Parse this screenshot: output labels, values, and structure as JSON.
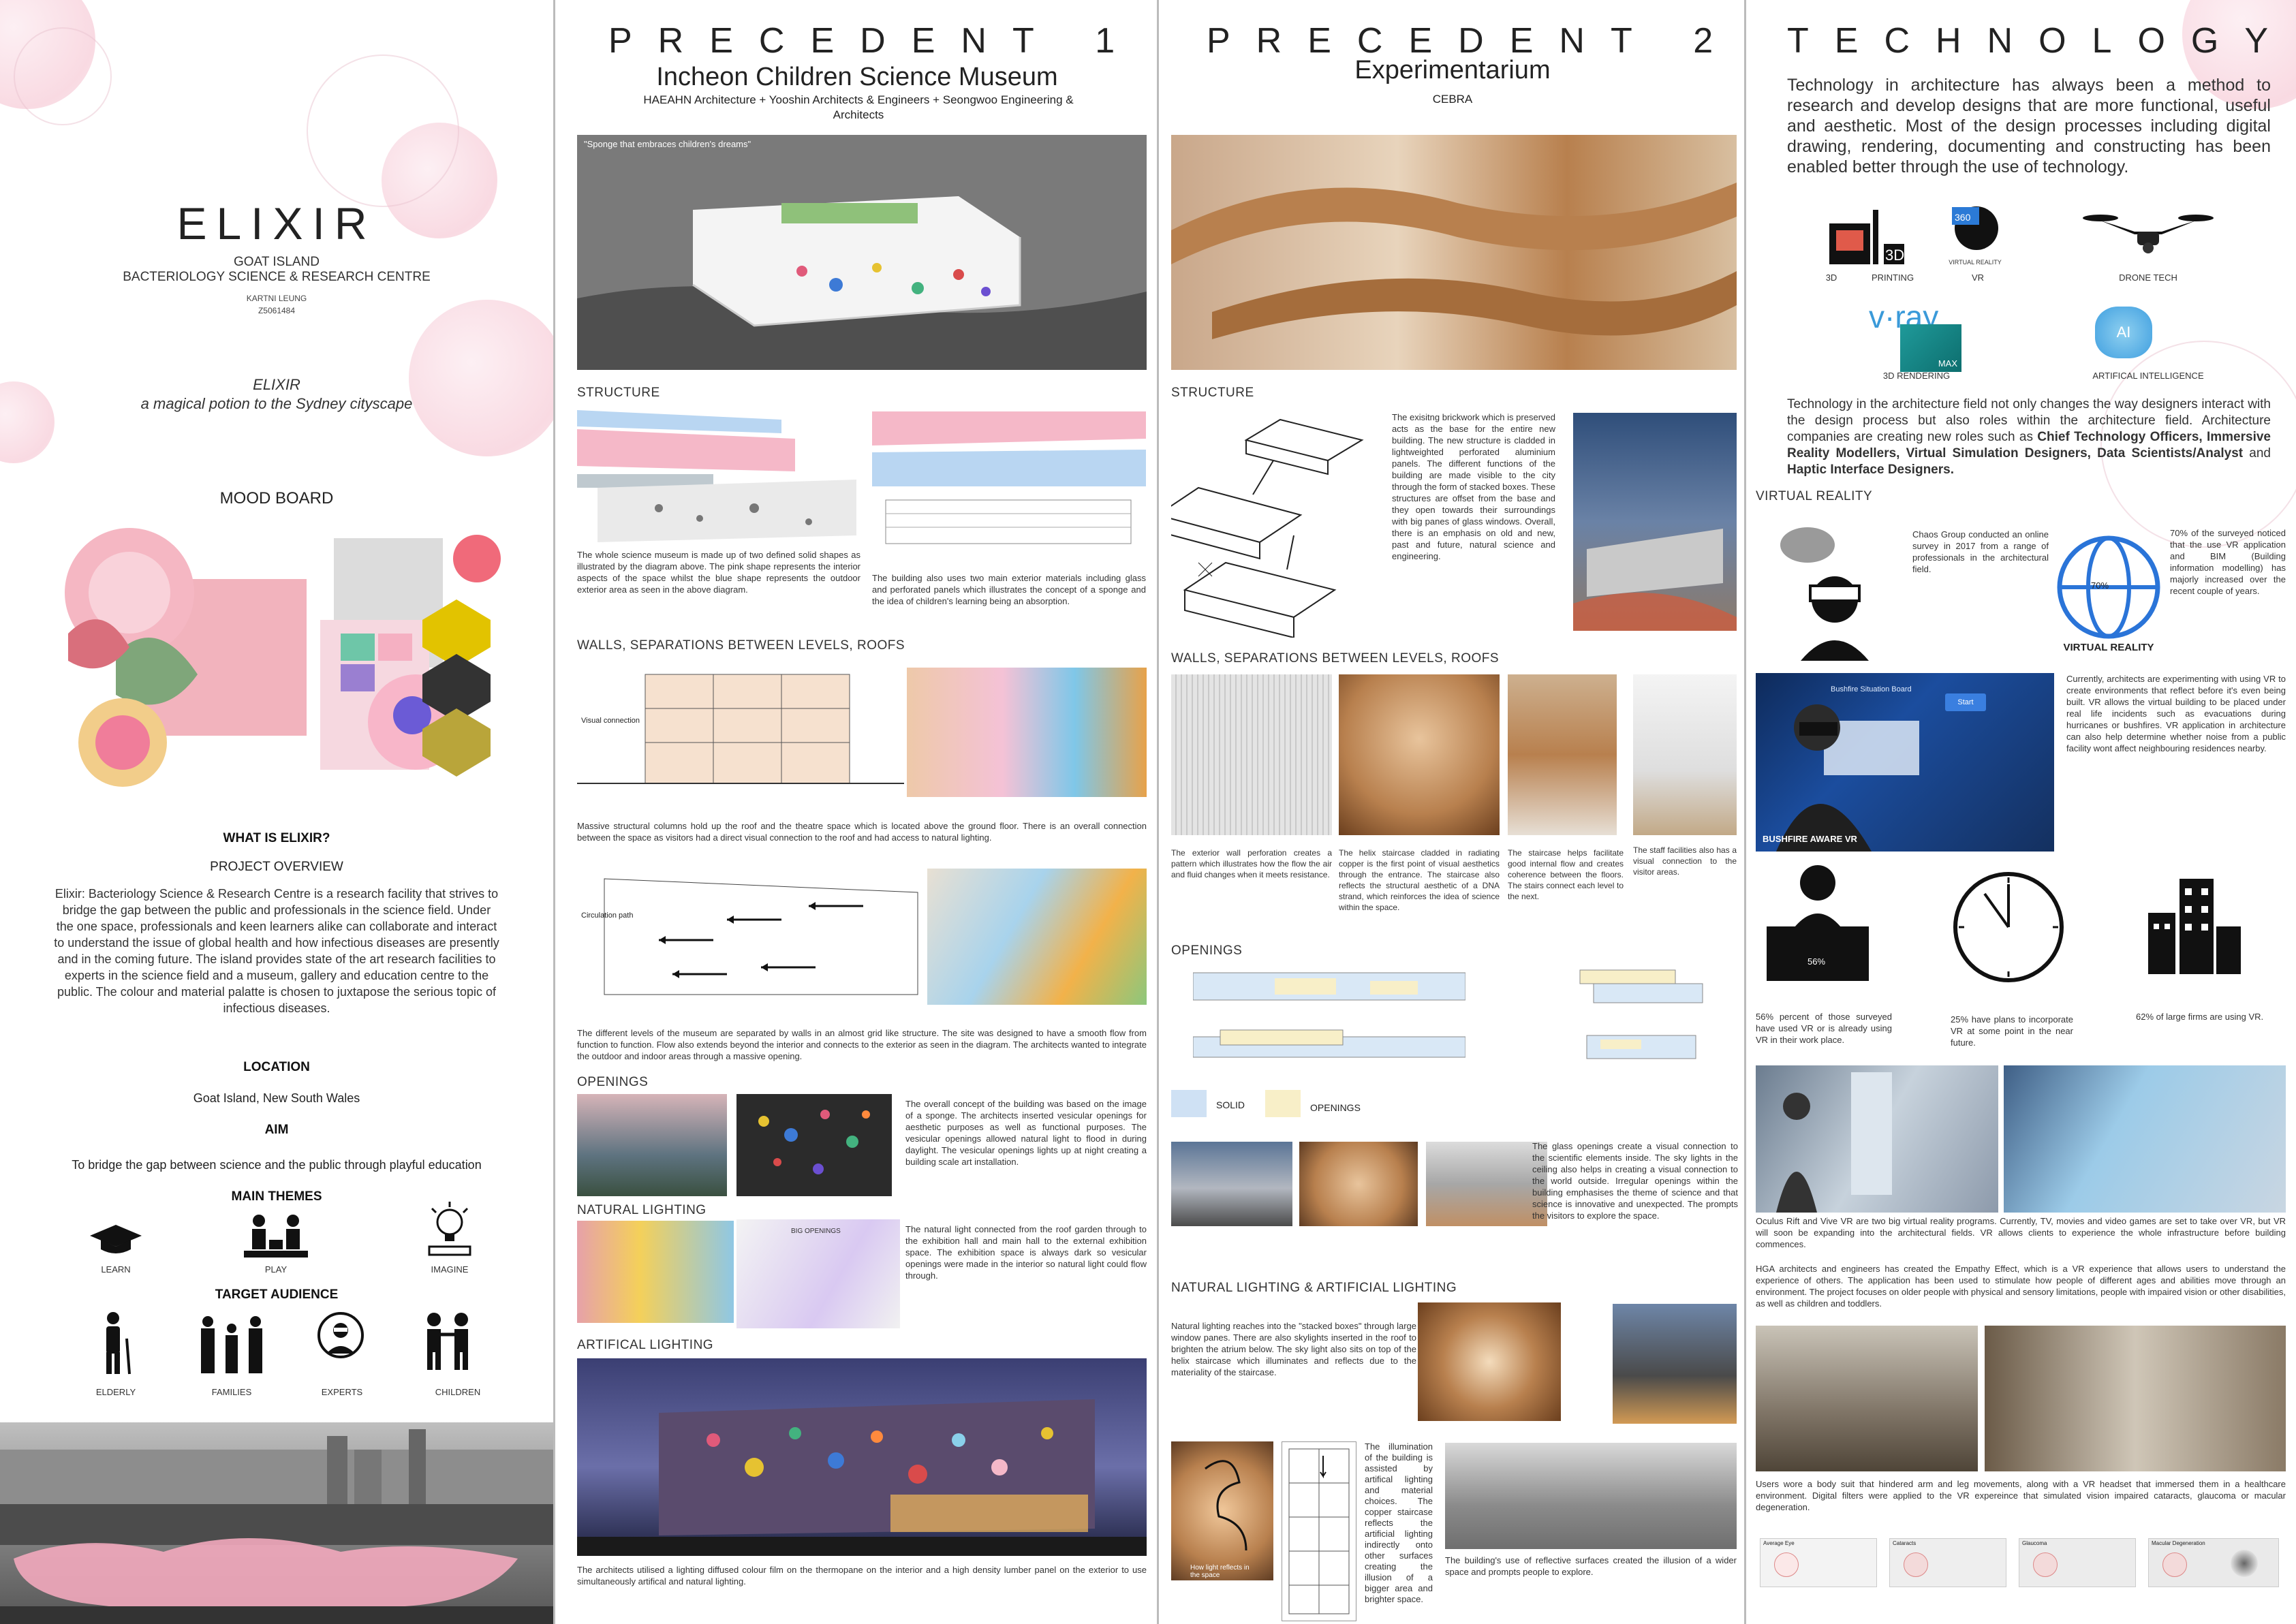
{
  "panel1": {
    "title": "ELIXIR",
    "subtitle1": "GOAT ISLAND",
    "subtitle2": "BACTERIOLOGY SCIENCE & RESEARCH CENTRE",
    "author": "KARTNI LEUNG",
    "student_id": "Z5061484",
    "tagline1": "ELIXIR",
    "tagline2": "a magical potion to the Sydney cityscape",
    "mood_board": "MOOD BOARD",
    "what_is": "WHAT IS ELIXIR?",
    "project_overview": "PROJECT OVERVIEW",
    "overview_text": "Elixir: Bacteriology Science & Research Centre is a research facility that strives to bridge the gap between the public and professionals in the science field. Under the one space, professionals and keen learners alike can collaborate and interact to understand the issue of global health and how infectious diseases are presently and in the coming future. The island provides state of the art research facilities to experts in the science field and a museum, gallery and education centre to the public. The colour and material palatte is chosen to juxtapose the serious topic of infectious diseases.",
    "location_h": "LOCATION",
    "location": "Goat Island, New South Wales",
    "aim_h": "AIM",
    "aim": "To bridge the gap between science and the public through playful education",
    "themes_h": "MAIN THEMES",
    "themes": [
      "LEARN",
      "PLAY",
      "IMAGINE"
    ],
    "audience_h": "TARGET AUDIENCE",
    "audience": [
      "ELDERLY",
      "FAMILIES",
      "EXPERTS",
      "CHILDREN"
    ]
  },
  "panel2": {
    "title": "PRECEDENT 1",
    "name": "Incheon Children Science Museum",
    "architects": "HAEAHN Architecture + Yooshin Architects & Engineers + Seongwoo Engineering & Architects",
    "quote": "\"Sponge that embraces children's dreams\"",
    "structure_h": "STRUCTURE",
    "structure_text1": "The whole science museum is made up of two defined solid shapes as illustrated by the diagram above. The pink shape represents the interior aspects of the space whilst the blue shape represents the outdoor exterior area as seen in the above diagram.",
    "structure_text2": "The building also uses two main exterior materials including glass and perforated panels which illustrates the concept of a sponge and the idea of children's learning being an absorption.",
    "walls_h": "WALLS, SEPARATIONS BETWEEN LEVELS, ROOFS",
    "visual_label": "Visual connection",
    "walls_text1": "Massive structural columns hold up the roof and the theatre space which is located above the ground floor. There is an overall connection between the space as visitors had a direct visual connection to the roof and had access to natural lighting.",
    "circ_label": "Circulation path",
    "walls_text2": "The different levels of the museum are separated by walls in an almost grid like structure. The site was designed to have a smooth flow from function to function. Flow also extends beyond the interior and connects to the exterior as seen in the diagram. The architects wanted to integrate the outdoor and indoor areas through a massive opening.",
    "openings_h": "OPENINGS",
    "openings_text": "The overall concept of the building was based on the image of a sponge. The architects inserted vesicular openings for aesthetic purposes as well as functional purposes. The vesicular openings allowed natural light to flood in during daylight. The vesicular openings lights up at night creating a building scale art installation.",
    "natural_h": "NATURAL LIGHTING",
    "big_openings": "BIG OPENINGS",
    "natural_text": "The natural light connected from the roof garden through to the exhibition hall and main hall to the external exhibition space. The exhibition space is always dark so vesicular openings were made in the interior so natural light could flow through.",
    "artificial_h": "ARTIFICAL LIGHTING",
    "artificial_text": "The architects utilised a lighting diffused colour film on the thermopane on the interior and a high density lumber panel on the exterior to use simultaneously artifical and natural lighting."
  },
  "panel3": {
    "title": "PRECEDENT 2",
    "name": "Experimentarium",
    "architect": "CEBRA",
    "structure_h": "STRUCTURE",
    "structure_text": "The exisitng brickwork which is preserved acts as the base for the entire new building. The new structure is cladded in lightweighted perforated aluminium panels. The different functions of the building are made visible to the city through the form of stacked boxes. These structures are offset from the base and they open towards their surroundings with big panes of glass windows. Overall, there is an emphasis on old and new, past and future, natural science and engineering.",
    "walls_h": "WALLS, SEPARATIONS BETWEEN LEVELS, ROOFS",
    "walls_captions": [
      "The exterior wall perforation creates a pattern which illustrates how the flow the air and fluid changes when it meets resistance.",
      "The helix staircase cladded in radiating copper is the first point of visual aesthetics through the entrance. The staircase also reflects the structural aesthetic of a DNA strand, which reinforces the idea of science within the space.",
      "The staircase helps facilitate good internal flow and creates coherence between the floors. The stairs connect each level to the next.",
      "The staff facilities also has a visual connection to the visitor areas."
    ],
    "openings_h": "OPENINGS",
    "legend_solid": "SOLID",
    "legend_openings": "OPENINGS",
    "openings_text": "The glass openings create a visual connection to the scientific elements inside. The sky lights in the ceiling also helps in creating a visual connection to the world outside. Irregular openings within the building emphasises the theme of science and that science is innovative and unexpected. The prompts the visitors to explore the space.",
    "lighting_h": "NATURAL LIGHTING & ARTIFICIAL LIGHTING",
    "lighting_text1": "Natural lighting reaches into the \"stacked boxes\" through large window panes. There are also skylights inserted in the roof to brighten the atrium below. The sky light also sits on top of the helix staircase which illuminates and reflects due to the materiality of the staircase.",
    "sketch_label": "How light reflects in the space",
    "lighting_text2": "The illumination of the building is assisted by artifical lighting and material choices. The copper staircase reflects the artificial lighting indirectly onto other surfaces creating the illusion of a bigger area and brighter space.",
    "lighting_text3": "The building's use of reflective surfaces created the illusion of a wider space and prompts people to explore."
  },
  "panel4": {
    "title": "TECHNOLOGY",
    "intro": "Technology in architecture has always been a method to research and develop designs that are more functional, useful and aesthetic. Most of the design processes including digital drawing, rendering, documenting and constructing has been enabled better through the use of technology.",
    "tech_labels": [
      "3D",
      "PRINTING",
      "VR",
      "DRONE TECH",
      "3D RENDERING",
      "ARTIFICAL INTELLIGENCE"
    ],
    "vr_label_small": "VIRTUAL REALITY",
    "vray": "v·ray",
    "max": "MAX",
    "ai": "AI",
    "roles_text_a": "Technology in the architecture field not only changes the way designers interact with the design process but also roles within the architecture field. Architecture companies are creating new roles such as ",
    "roles_bold": "Chief Technology Officers, Immersive Reality Modellers, Virtual Simulation Designers, Data Scientists/Analyst",
    "roles_and": " and ",
    "roles_bold2": "Haptic Interface Designers.",
    "vr_h": "VIRTUAL REALITY",
    "chaos_text": "Chaos Group conducted an online survey in 2017 from a range of professionals in the architectural field.",
    "percent70": "70%",
    "vr_globe_label": "VIRTUAL REALITY",
    "survey70_text": "70% of the surveyed noticed that the use VR application and BIM (Building information modelling) has majorly increased over the recent couple of years.",
    "bushfire_label": "BUSHFIRE AWARE VR",
    "bushfire_board": "Bushfire Situation Board",
    "bushfire_start": "Start",
    "bushfire_text": "Currently, architects are experimenting with using VR to create environments that reflect before it's even being built. VR allows the virtual building to be placed under real life incidents such as evacuations during hurricanes or bushfires. VR application in architecture can also help determine whether noise from a public facility wont affect neighbouring residences nearby.",
    "stat56_label": "56%",
    "stat56": "56% percent of those surveyed have used VR or is already using VR in their work place.",
    "stat25": "25% have plans to incorporate VR at some point in the near future.",
    "stat62": "62% of large firms are using VR.",
    "oculus_text": "Oculus Rift and Vive VR are two big virtual reality programs. Currently, TV, movies and video games are set to take over VR, but VR will soon be expanding into the architectural fields. VR allows clients to experience the whole infrastructure before building commences.",
    "hga_text": "HGA architects and engineers has created the Empathy Effect, which is a VR experience that allows users to understand the experience of others. The application has been used to stimulate how people of different ages and abilities move through an environment. The project focuses on older people with physical and sensory limitations, people with impaired vision or other disabilities, as well as children and toddlers.",
    "suit_text": "Users wore a body suit that hindered arm and leg movements, along with a VR headset that immersed them in a healthcare environment. Digital filters were applied to the VR expereince that simulated vision impaired cataracts, glaucoma or macular degeneration.",
    "eye_labels": [
      "Average Eye",
      "Cataracts",
      "Glaucoma",
      "Macular Degeneration"
    ]
  },
  "colors": {
    "pink": "#f5b8c8",
    "blue": "#b9d6f2",
    "cream": "#f8efc8",
    "copper": "#b8804e"
  }
}
